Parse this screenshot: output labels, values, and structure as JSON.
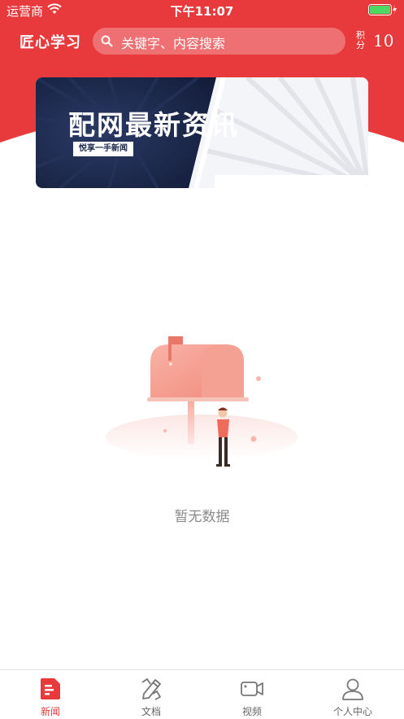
{
  "status_bar": {
    "carrier": "运营商",
    "time": "下午11:07"
  },
  "header": {
    "app_title": "匠心学习",
    "search_placeholder": "关键字、内容搜索",
    "points_label": "积分",
    "points_value": "10"
  },
  "banner": {
    "title": "配网最新资讯",
    "tagline": "悦享一手新闻"
  },
  "empty_state": {
    "message": "暂无数据"
  },
  "tab_bar": {
    "tabs": [
      {
        "label": "新闻",
        "icon": "news-icon",
        "active": true
      },
      {
        "label": "文档",
        "icon": "document-edit-icon",
        "active": false
      },
      {
        "label": "视频",
        "icon": "video-camera-icon",
        "active": false
      },
      {
        "label": "个人中心",
        "icon": "user-icon",
        "active": false
      }
    ]
  },
  "colors": {
    "brand_red": "#e8393c",
    "banner_navy": "#1e2a4c",
    "inactive_gray": "#666666",
    "empty_text": "#8a8a8a"
  }
}
